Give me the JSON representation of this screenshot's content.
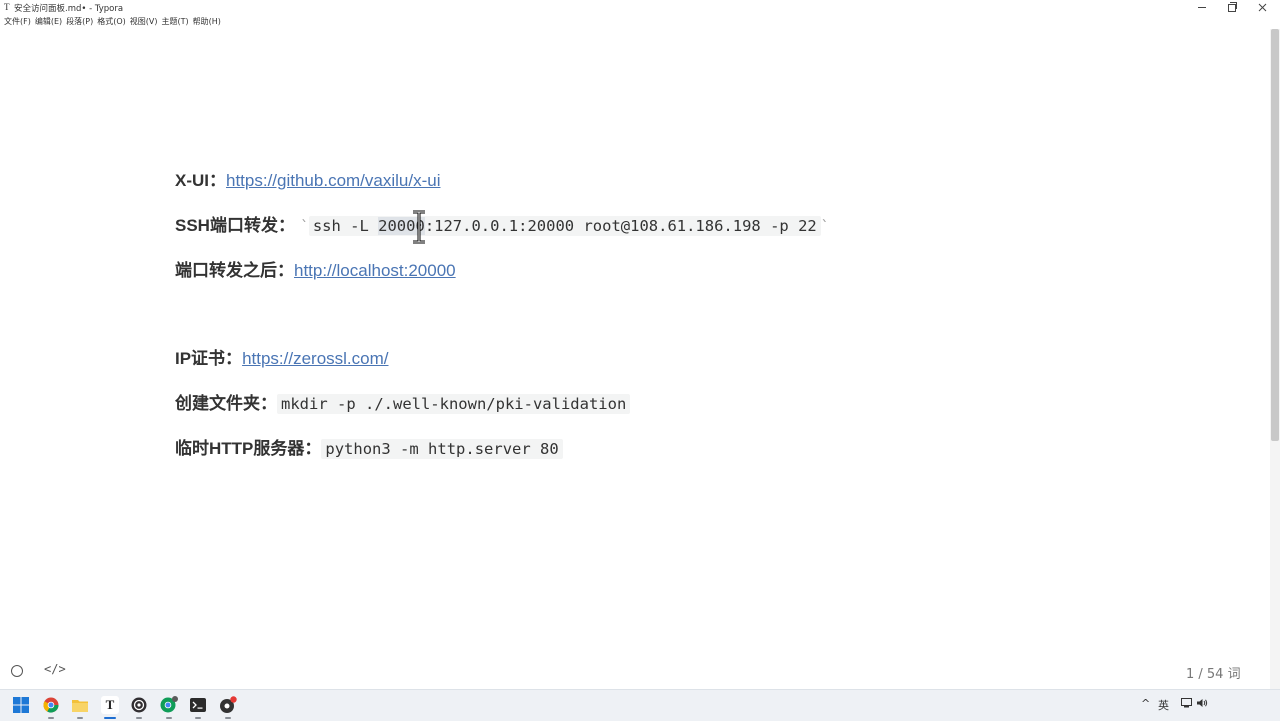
{
  "window": {
    "app_icon": "T",
    "title": "安全访问面板.md• - Typora"
  },
  "menu": [
    "文件(F)",
    "编辑(E)",
    "段落(P)",
    "格式(O)",
    "视图(V)",
    "主题(T)",
    "帮助(H)"
  ],
  "content": {
    "line1": {
      "label": "X-UI：",
      "link": "https://github.com/vaxilu/x-ui"
    },
    "line2": {
      "label": "SSH端口转发：",
      "tick_open": "`",
      "code_pre": "ssh -L ",
      "code_sel": "20000",
      "code_post": ":127.0.0.1:20000 root@108.61.186.198 -p 22",
      "tick_close": "`"
    },
    "line3": {
      "label": "端口转发之后：",
      "link": "http://localhost:20000"
    },
    "line4": {
      "label": "IP证书：",
      "link": "https://zerossl.com/"
    },
    "line5": {
      "label": "创建文件夹：",
      "code": "mkdir -p ./.well-known/pki-validation"
    },
    "line6": {
      "label": "临时HTTP服务器：",
      "code": "python3 -m http.server 80"
    }
  },
  "status": {
    "source_toggle": "</>",
    "word_count": "1 / 54 词"
  },
  "taskbar": {
    "icons": [
      "windows-start-icon",
      "chrome-icon",
      "file-explorer-icon",
      "typora-icon",
      "obs-icon",
      "chrome-profile-icon",
      "terminal-icon",
      "app-badge-icon"
    ],
    "tray": {
      "chevron": "^",
      "ime": "英"
    }
  },
  "colors": {
    "link": "#4a75b4",
    "code_bg": "#f3f4f4",
    "taskbar_bg": "#eef1f5"
  }
}
